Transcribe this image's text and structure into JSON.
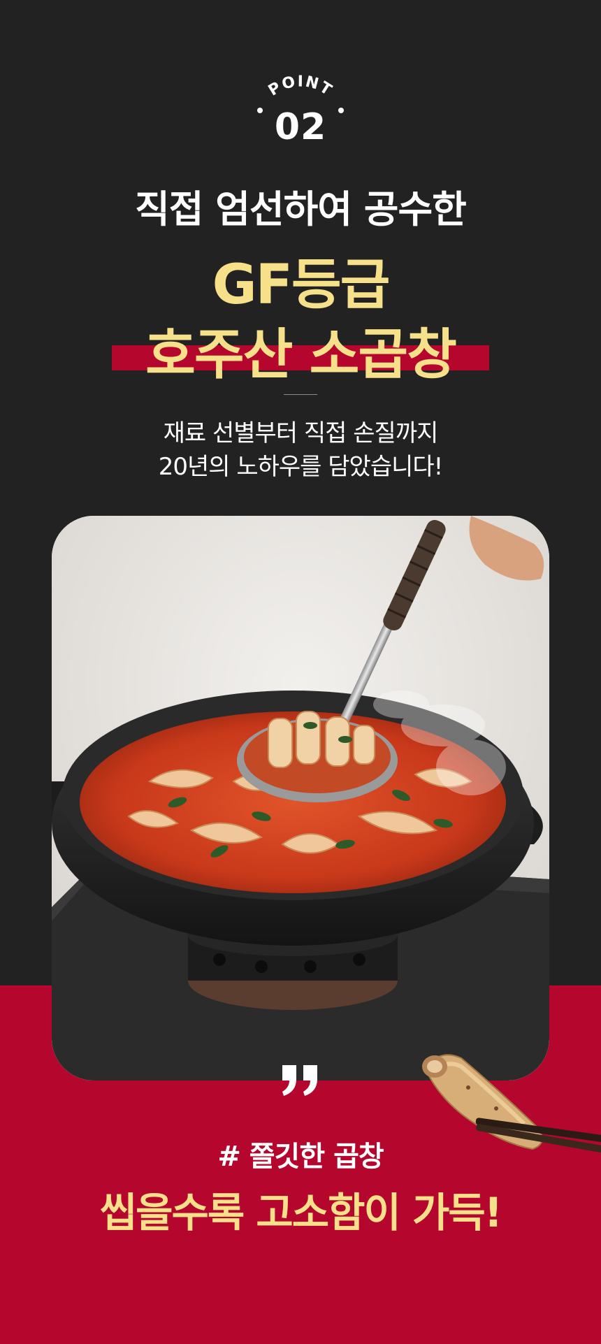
{
  "badge": {
    "label": "POINT",
    "number": "02"
  },
  "headline": {
    "intro": "직접 엄선하여 공수한",
    "highlight_line1": "GF등급",
    "highlight_line2": "호주산 소곱창"
  },
  "description": {
    "line1": "재료 선별부터 직접 손질까지",
    "line2": "20년의 노하우를 담았습니다!"
  },
  "tagline": {
    "hashtag": "# 쫄깃한 곱창",
    "slogan": "씹을수록 고소함이 가득!"
  },
  "colors": {
    "dark_background": "#222222",
    "brand_red": "#b5062d",
    "accent_yellow": "#f6e08a",
    "text_white": "#ffffff"
  },
  "icons": {
    "quote": "closing-quote-icon"
  }
}
